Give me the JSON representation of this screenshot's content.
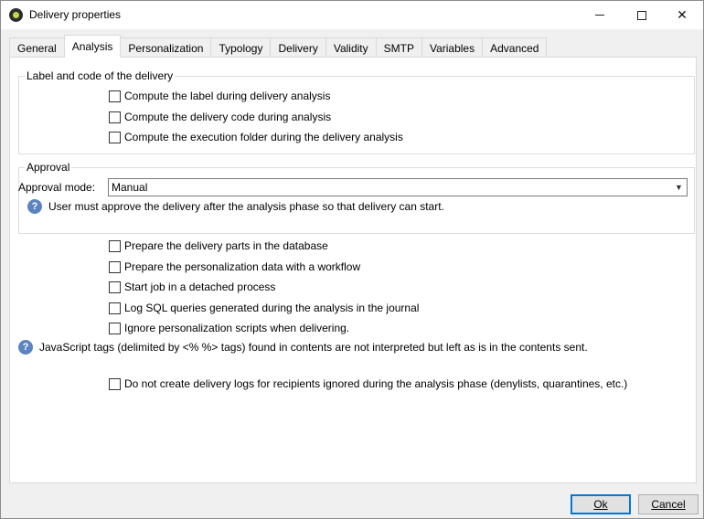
{
  "window": {
    "title": "Delivery properties"
  },
  "tabs": [
    {
      "label": "General"
    },
    {
      "label": "Analysis",
      "active": true
    },
    {
      "label": "Personalization"
    },
    {
      "label": "Typology"
    },
    {
      "label": "Delivery"
    },
    {
      "label": "Validity"
    },
    {
      "label": "SMTP"
    },
    {
      "label": "Variables"
    },
    {
      "label": "Advanced"
    }
  ],
  "label_group": {
    "title": "Label and code of the delivery",
    "options": [
      {
        "label": "Compute the label during delivery analysis",
        "checked": false
      },
      {
        "label": "Compute the delivery code during analysis",
        "checked": false
      },
      {
        "label": "Compute the execution folder during the delivery analysis",
        "checked": false
      }
    ]
  },
  "approval_group": {
    "title": "Approval",
    "mode_label": "Approval mode:",
    "mode_value": "Manual",
    "info": "User must approve the delivery after the analysis phase so that delivery can start."
  },
  "options": [
    {
      "label": "Prepare the delivery parts in the database",
      "checked": false
    },
    {
      "label": "Prepare the personalization data with a workflow",
      "checked": false
    },
    {
      "label": "Start job in a detached process",
      "checked": false
    },
    {
      "label": "Log SQL queries generated during the analysis in the journal",
      "checked": false
    },
    {
      "label": "Ignore personalization scripts when delivering.",
      "checked": false
    }
  ],
  "js_info": "JavaScript tags (delimited by <% %> tags) found in contents are not interpreted but left as is in the contents sent.",
  "logs_option": {
    "label": "Do not create delivery logs for recipients ignored during the analysis phase (denylists, quarantines, etc.)",
    "checked": false
  },
  "buttons": {
    "ok_label": "Ok",
    "cancel_label": "Cancel"
  },
  "colors": {
    "accent": "#0078d7",
    "info_icon": "#5b84c0"
  }
}
